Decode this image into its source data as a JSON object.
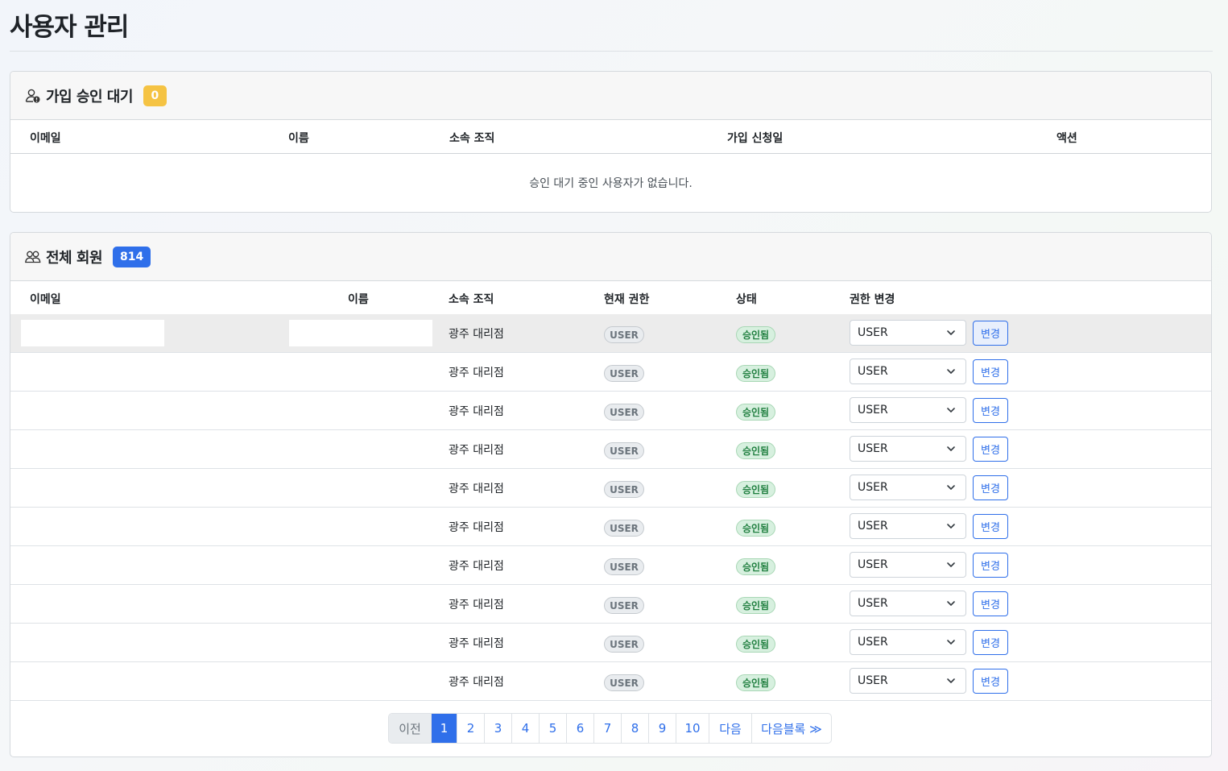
{
  "page": {
    "title": "사용자 관리"
  },
  "pending": {
    "title": "가입 승인 대기",
    "count": "0",
    "columns": [
      "이메일",
      "이름",
      "소속 조직",
      "가입 신청일",
      "액션"
    ],
    "empty_message": "승인 대기 중인 사용자가 없습니다."
  },
  "members": {
    "title": "전체 회원",
    "count": "814",
    "columns": [
      "이메일",
      "이름",
      "소속 조직",
      "현재 권한",
      "상태",
      "권한 변경"
    ],
    "rows": [
      {
        "email": "",
        "name": "",
        "org": "광주 대리점",
        "role": "USER",
        "status": "승인됨",
        "select_value": "USER",
        "action": "변경"
      },
      {
        "email": "",
        "name": "",
        "org": "광주 대리점",
        "role": "USER",
        "status": "승인됨",
        "select_value": "USER",
        "action": "변경"
      },
      {
        "email": "",
        "name": "",
        "org": "광주 대리점",
        "role": "USER",
        "status": "승인됨",
        "select_value": "USER",
        "action": "변경"
      },
      {
        "email": "",
        "name": "",
        "org": "광주 대리점",
        "role": "USER",
        "status": "승인됨",
        "select_value": "USER",
        "action": "변경"
      },
      {
        "email": "",
        "name": "",
        "org": "광주 대리점",
        "role": "USER",
        "status": "승인됨",
        "select_value": "USER",
        "action": "변경"
      },
      {
        "email": "",
        "name": "",
        "org": "광주 대리점",
        "role": "USER",
        "status": "승인됨",
        "select_value": "USER",
        "action": "변경"
      },
      {
        "email": "",
        "name": "",
        "org": "광주 대리점",
        "role": "USER",
        "status": "승인됨",
        "select_value": "USER",
        "action": "변경"
      },
      {
        "email": "",
        "name": "",
        "org": "광주 대리점",
        "role": "USER",
        "status": "승인됨",
        "select_value": "USER",
        "action": "변경"
      },
      {
        "email": "",
        "name": "",
        "org": "광주 대리점",
        "role": "USER",
        "status": "승인됨",
        "select_value": "USER",
        "action": "변경"
      },
      {
        "email": "",
        "name": "",
        "org": "광주 대리점",
        "role": "USER",
        "status": "승인됨",
        "select_value": "USER",
        "action": "변경"
      }
    ]
  },
  "pagination": {
    "prev": "이전",
    "pages": [
      "1",
      "2",
      "3",
      "4",
      "5",
      "6",
      "7",
      "8",
      "9",
      "10"
    ],
    "current": "1",
    "next": "다음",
    "next_block": "다음블록 ≫"
  },
  "colors": {
    "primary": "#2f6fea",
    "warning": "#f5c343",
    "success_text": "#1e7e3e"
  },
  "icons": {
    "pending": "person-clock-icon",
    "members": "people-icon",
    "select": "chevron-down-icon"
  }
}
